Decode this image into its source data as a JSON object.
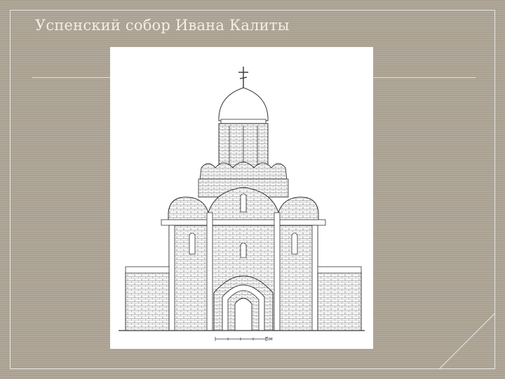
{
  "slide": {
    "title": "Успенский собор Ивана Калиты",
    "figure": {
      "icon": "cathedral-elevation-drawing",
      "scale_label": "5м"
    }
  },
  "colors": {
    "background": "#a9a091",
    "title_text": "#f3eee2",
    "frame_line": "#ffffff",
    "drawing_line": "#444444"
  }
}
